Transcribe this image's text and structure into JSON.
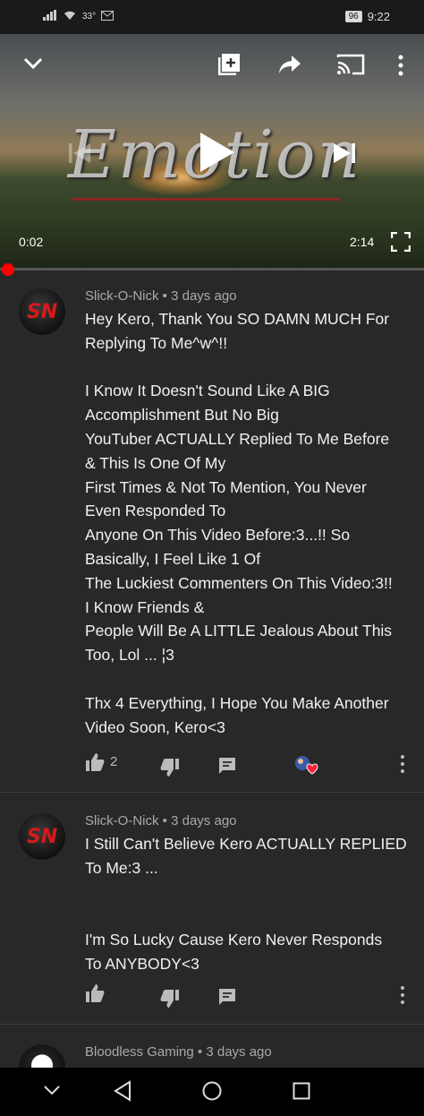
{
  "status_bar": {
    "signal_text": "33°",
    "battery": "96",
    "time": "9:22"
  },
  "player": {
    "art_title": "Emotion",
    "current_time": "0:02",
    "duration": "2:14",
    "progress_fraction": 0.015
  },
  "icons": {
    "collapse": "chevron-down-icon",
    "add_to_queue": "add-to-queue-icon",
    "share": "share-icon",
    "cast": "cast-icon",
    "more": "more-vert-icon",
    "play": "play-icon",
    "previous": "previous-icon",
    "next": "next-icon",
    "fullscreen": "fullscreen-icon"
  },
  "comments": [
    {
      "author": "Slick-O-Nick",
      "time": "3 days ago",
      "avatar_text": "SN",
      "text": "Hey Kero, Thank You SO DAMN MUCH For\nReplying To Me^w^!!\n\nI Know It Doesn't Sound Like A BIG\nAccomplishment But No Big\nYouTuber ACTUALLY Replied To Me Before\n& This Is One Of My\nFirst Times & Not To Mention, You Never\nEven Responded To\nAnyone On This Video Before:3...!! So\nBasically, I Feel Like 1 Of\nThe Luckiest Commenters On This Video:3!!\nI Know Friends &\nPeople Will Be A LITTLE Jealous About This\nToo, Lol ... ¦3\n\nThx 4 Everything, I Hope You Make Another\nVideo Soon, Kero<3",
      "likes": "2",
      "creator_heart": true
    },
    {
      "author": "Slick-O-Nick",
      "time": "3 days ago",
      "avatar_text": "SN",
      "text": "I Still Can't Believe Kero ACTUALLY REPLIED\nTo Me:3 ...\n\n\nI'm So Lucky Cause Kero Never Responds\nTo ANYBODY<3",
      "likes": "",
      "creator_heart": false
    },
    {
      "author": "Bloodless Gaming",
      "time": "3 days ago",
      "avatar_text": "",
      "text": "",
      "likes": "",
      "creator_heart": false
    }
  ],
  "meta_separator": "•"
}
